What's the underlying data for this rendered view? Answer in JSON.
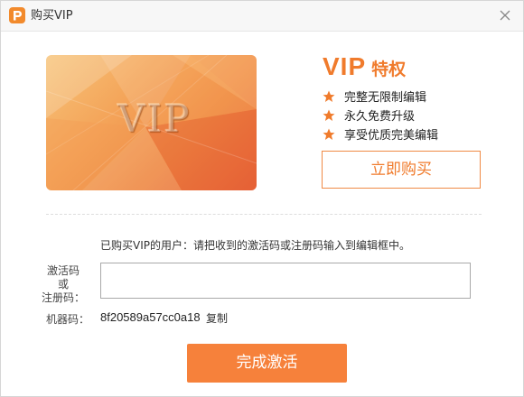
{
  "window": {
    "title": "购买VIP",
    "logo_icon": "app-logo-icon",
    "close_icon": "close-icon"
  },
  "card": {
    "text": "VIP"
  },
  "vip": {
    "title_main": "VIP",
    "title_sub": "特权",
    "perks": [
      "完整无限制编辑",
      "永久免费升级",
      "享受优质完美编辑"
    ],
    "perk_icon": "star-icon"
  },
  "buy_button": {
    "label": "立即购买"
  },
  "activation": {
    "hint": "已购买VIP的用户：请把收到的激活码或注册码输入到编辑框中。",
    "code_label_1": "激活码",
    "code_label_2": "或",
    "code_label_3": "注册码：",
    "code_value": "",
    "machine_label": "机器码：",
    "machine_code": "8f20589a57cc0a18",
    "copy_label": "复制",
    "activate_label": "完成激活"
  },
  "colors": {
    "accent": "#f07b2c",
    "button_fill": "#f6813b",
    "card_light": "#f7c47a",
    "card_dark": "#e8643a"
  }
}
